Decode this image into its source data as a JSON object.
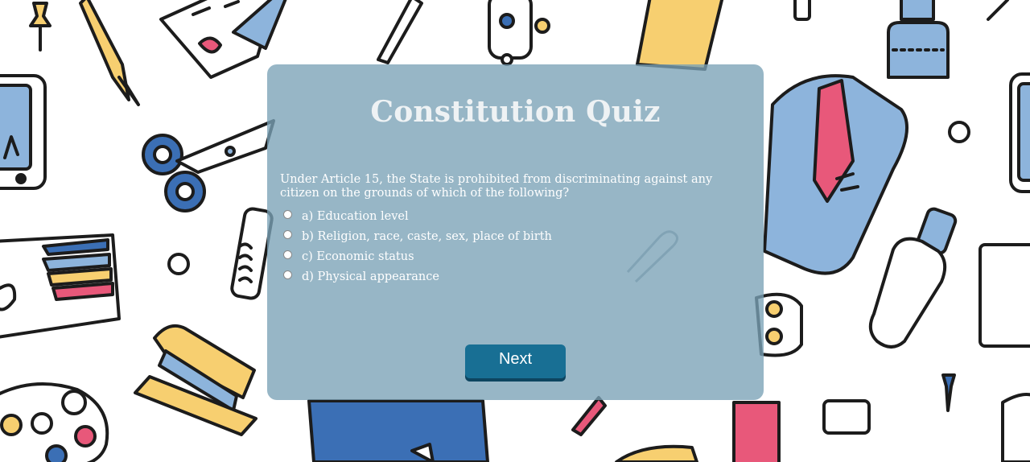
{
  "quiz": {
    "title": "Constitution Quiz",
    "question": "Under Article 15, the State is prohibited from discriminating against any citizen on the grounds of which of the following?",
    "options": [
      {
        "label": "a) Education level",
        "selected": false
      },
      {
        "label": "b) Religion, race, caste, sex, place of birth",
        "selected": false
      },
      {
        "label": "c) Economic status",
        "selected": false
      },
      {
        "label": "d) Physical appearance",
        "selected": false
      }
    ],
    "next_label": "Next"
  },
  "background": {
    "theme": "stationery-doodles",
    "icons": [
      "pushpin-icon",
      "pencil-icon",
      "paint-brush-icon",
      "scissors-icon",
      "phone-icon",
      "glue-bottle-icon",
      "notebook-icon",
      "stapler-icon",
      "paint-palette-icon",
      "ruler-icon",
      "eraser-icon",
      "paper-clip-icon",
      "book-icon",
      "glue-stick-icon",
      "marker-icon"
    ]
  },
  "colors": {
    "card": "#7aa1b6",
    "button": "#186f94",
    "doodle_blue": "#8db4dc",
    "doodle_yellow": "#f7cf70",
    "doodle_pink": "#e8587a",
    "doodle_outline": "#1c1c1c"
  }
}
